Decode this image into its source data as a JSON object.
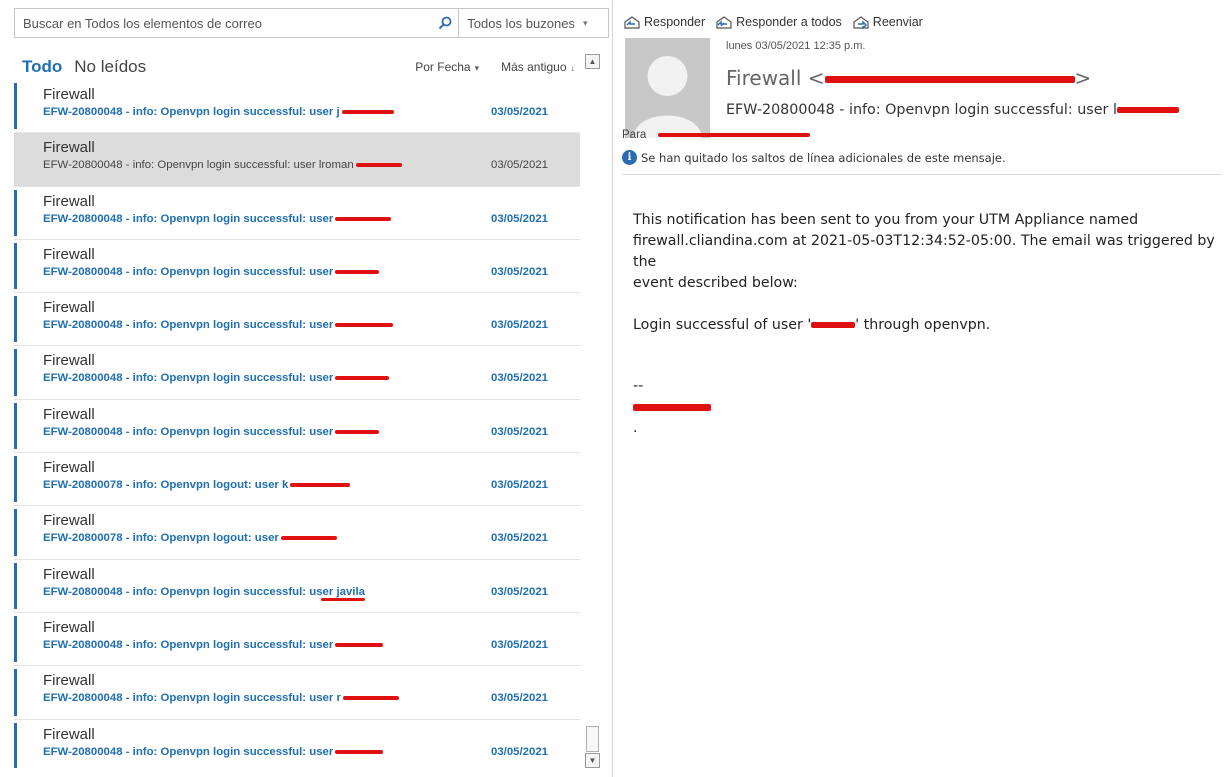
{
  "search": {
    "placeholder": "Buscar en Todos los elementos de correo",
    "scope": "Todos los buzones"
  },
  "filters": {
    "all": "Todo",
    "unread": "No leídos",
    "sort_by": "Por Fecha",
    "sort_order": "Más antiguo"
  },
  "messages": [
    {
      "sender": "Firewall",
      "subject": "EFW-20800048 - info: Openvpn login successful: user j",
      "date": "03/05/2021",
      "unread": true
    },
    {
      "sender": "Firewall",
      "subject": "EFW-20800048 - info: Openvpn login successful: user lroman",
      "date": "03/05/2021",
      "unread": false,
      "selected": true
    },
    {
      "sender": "Firewall",
      "subject": "EFW-20800048 - info: Openvpn login successful: user",
      "date": "03/05/2021",
      "unread": true
    },
    {
      "sender": "Firewall",
      "subject": "EFW-20800048 - info: Openvpn login successful: user",
      "date": "03/05/2021",
      "unread": true
    },
    {
      "sender": "Firewall",
      "subject": "EFW-20800048 - info: Openvpn login successful: user",
      "date": "03/05/2021",
      "unread": true
    },
    {
      "sender": "Firewall",
      "subject": "EFW-20800048 - info: Openvpn login successful: user",
      "date": "03/05/2021",
      "unread": true
    },
    {
      "sender": "Firewall",
      "subject": "EFW-20800048 - info: Openvpn login successful: user",
      "date": "03/05/2021",
      "unread": true
    },
    {
      "sender": "Firewall",
      "subject": "EFW-20800078 - info: Openvpn logout: user k",
      "date": "03/05/2021",
      "unread": true
    },
    {
      "sender": "Firewall",
      "subject": "EFW-20800078 - info: Openvpn logout: user",
      "date": "03/05/2021",
      "unread": true
    },
    {
      "sender": "Firewall",
      "subject": "EFW-20800048 - info: Openvpn login successful: user javila",
      "date": "03/05/2021",
      "unread": true
    },
    {
      "sender": "Firewall",
      "subject": "EFW-20800048 - info: Openvpn login successful: user",
      "date": "03/05/2021",
      "unread": true
    },
    {
      "sender": "Firewall",
      "subject": "EFW-20800048 - info: Openvpn login successful: user r",
      "date": "03/05/2021",
      "unread": true
    },
    {
      "sender": "Firewall",
      "subject": "EFW-20800048 - info: Openvpn login successful: user",
      "date": "03/05/2021",
      "unread": true
    }
  ],
  "reading": {
    "actions": {
      "reply": "Responder",
      "reply_all": "Responder a todos",
      "forward": "Reenviar"
    },
    "timestamp": "lunes 03/05/2021 12:35 p.m.",
    "from_name": "Firewall <",
    "from_close": ">",
    "subject": "EFW-20800048 - info: Openvpn login successful: user l",
    "to_label": "Para",
    "info_notice": "Se han quitado los saltos de línea adicionales de este mensaje.",
    "body": {
      "line1": "This notification has been sent to you from your UTM Appliance named",
      "line2": "firewall.cliandina.com at 2021-05-03T12:34:52-05:00. The email was triggered by the",
      "line3": "event described below:",
      "line4_prefix": "Login successful of user '",
      "line4_suffix": "' through openvpn.",
      "sig_dash": "--",
      "sig_dot": "."
    }
  },
  "colors": {
    "accent": "#1f6fb5",
    "unread_bar": "#2b6cb0",
    "selected_bg": "#dcdcdc",
    "redaction": "#e01010"
  }
}
